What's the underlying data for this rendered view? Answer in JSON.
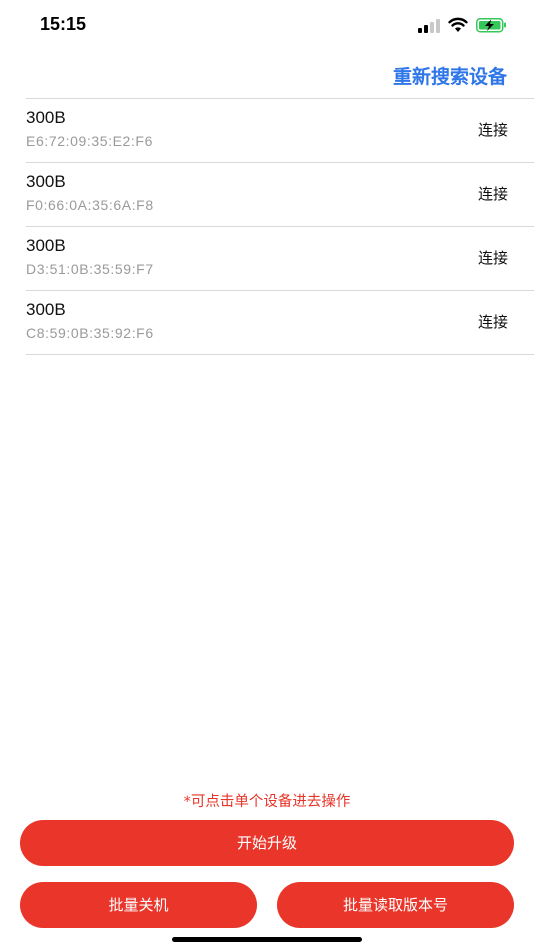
{
  "status_bar": {
    "time": "15:15",
    "icons": [
      "cellular-signal-icon",
      "wifi-icon",
      "battery-charging-icon"
    ],
    "battery_color": "#34C759"
  },
  "header": {
    "rescan_label": "重新搜索设备"
  },
  "devices": [
    {
      "name": "300B",
      "mac": "E6:72:09:35:E2:F6",
      "action": "连接"
    },
    {
      "name": "300B",
      "mac": "F0:66:0A:35:6A:F8",
      "action": "连接"
    },
    {
      "name": "300B",
      "mac": "D3:51:0B:35:59:F7",
      "action": "连接"
    },
    {
      "name": "300B",
      "mac": "C8:59:0B:35:92:F6",
      "action": "连接"
    }
  ],
  "footer": {
    "hint": "*可点击单个设备进去操作",
    "upgrade_label": "开始升级",
    "shutdown_label": "批量关机",
    "read_version_label": "批量读取版本号"
  },
  "colors": {
    "accent_blue": "#2F76E9",
    "accent_red": "#E9352A"
  }
}
